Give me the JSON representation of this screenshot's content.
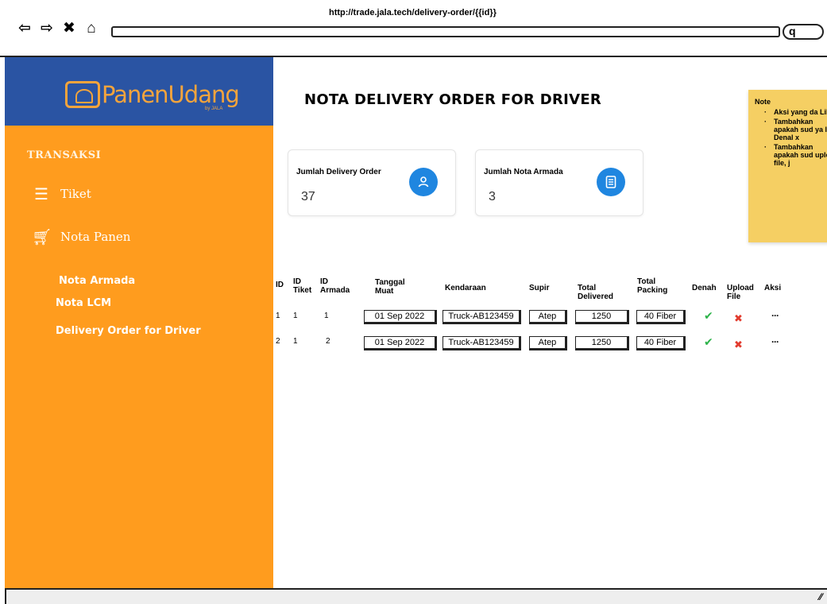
{
  "browser": {
    "url": "http://trade.jala.tech/delivery-order/{{id}}",
    "nav_icons": [
      "back-icon",
      "forward-icon",
      "close-icon",
      "home-icon"
    ]
  },
  "sidebar": {
    "brand": "PanenUdang",
    "brand_sub": "by JALA",
    "section_title": "TRANSAKSI",
    "items": [
      {
        "label": "Tiket",
        "icon": "ticket-icon"
      },
      {
        "label": "Nota Panen",
        "icon": "cart-icon"
      }
    ],
    "sub_items": [
      "Nota Armada",
      "Nota LCM",
      "Delivery Order for Driver"
    ]
  },
  "main": {
    "title": "NOTA DELIVERY ORDER FOR DRIVER",
    "cards": [
      {
        "label": "Jumlah Delivery Order",
        "value": "37",
        "icon": "person-icon"
      },
      {
        "label": "Jumlah Nota Armada",
        "value": "3",
        "icon": "document-icon"
      }
    ],
    "note": {
      "title": "Note",
      "items": [
        "Aksi yang da Lihat",
        "Tambahkan apakah sud ya list Denal x",
        "Tambahkan apakah sud upload file, j"
      ]
    },
    "table": {
      "headers": {
        "id": "ID",
        "id_tiket": "ID Tiket",
        "id_armada": "ID Armada",
        "tanggal_muat": "Tanggal Muat",
        "kendaraan": "Kendaraan",
        "supir": "Supir",
        "total_delivered": "Total Delivered",
        "total_packing": "Total Packing",
        "denah": "Denah",
        "upload_file": "Upload File",
        "aksi": "Aksi"
      },
      "rows": [
        {
          "id": "1",
          "id_tiket": "1",
          "id_armada": "1",
          "tanggal": "01 Sep 2022",
          "kendaraan": "Truck-AB123459",
          "supir": "Atep",
          "delivered": "1250",
          "packing": "40 Fiber",
          "denah": "✔",
          "upload": "✖",
          "aksi": "···"
        },
        {
          "id": "2",
          "id_tiket": "1",
          "id_armada": "2",
          "tanggal": "01 Sep 2022",
          "kendaraan": "Truck-AB123459",
          "supir": "Atep",
          "delivered": "1250",
          "packing": "40 Fiber",
          "denah": "✔",
          "upload": "✖",
          "aksi": "···"
        }
      ]
    }
  },
  "colors": {
    "sidebar": "#ff9c1e",
    "brand_bar": "#2a54a3",
    "card_icon": "#1f86e0",
    "note": "#f5cf63",
    "check": "#2db34a",
    "cross": "#e23b2e"
  }
}
